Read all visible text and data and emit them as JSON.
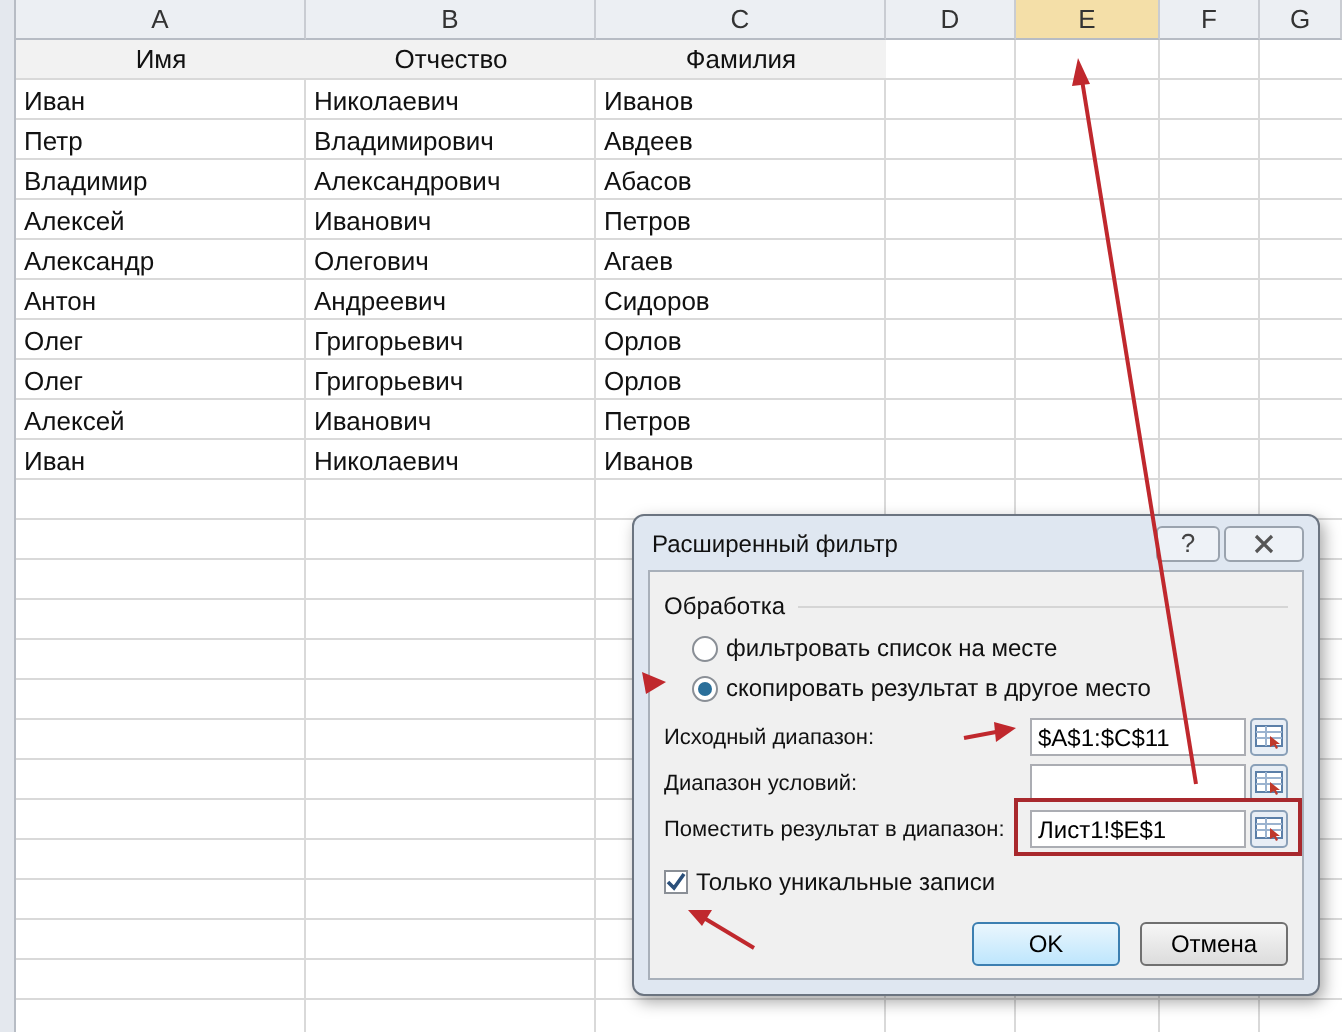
{
  "sheet": {
    "columns": [
      "A",
      "B",
      "C",
      "D",
      "E",
      "F",
      "G"
    ],
    "header_row": [
      "Имя",
      "Отчество",
      "Фамилия"
    ],
    "rows": [
      [
        "Иван",
        "Николаевич",
        "Иванов"
      ],
      [
        "Петр",
        "Владимирович",
        "Авдеев"
      ],
      [
        "Владимир",
        "Александрович",
        "Абасов"
      ],
      [
        "Алексей",
        "Иванович",
        "Петров"
      ],
      [
        "Александр",
        "Олегович",
        "Агаев"
      ],
      [
        "Антон",
        "Андреевич",
        "Сидоров"
      ],
      [
        "Олег",
        "Григорьевич",
        "Орлов"
      ],
      [
        "Олег",
        "Григорьевич",
        "Орлов"
      ],
      [
        "Алексей",
        "Иванович",
        "Петров"
      ],
      [
        "Иван",
        "Николаевич",
        "Иванов"
      ]
    ]
  },
  "dialog": {
    "title": "Расширенный фильтр",
    "help_button": "?",
    "group_label": "Обработка",
    "options": [
      {
        "label": "фильтровать список на месте",
        "selected": false
      },
      {
        "label": "скопировать результат в другое место",
        "selected": true
      }
    ],
    "fields": [
      {
        "label": "Исходный диапазон:",
        "value": "$A$1:$C$11"
      },
      {
        "label": "Диапазон условий:"
      },
      {
        "label": "Поместить результат в диапазон:",
        "value": "Лист1!$E$1"
      }
    ],
    "unique_only": {
      "label": "Только уникальные записи",
      "checked": true
    },
    "buttons": [
      {
        "label": "OK",
        "default": true
      },
      {
        "label": "Отмена",
        "default": false
      }
    ]
  }
}
